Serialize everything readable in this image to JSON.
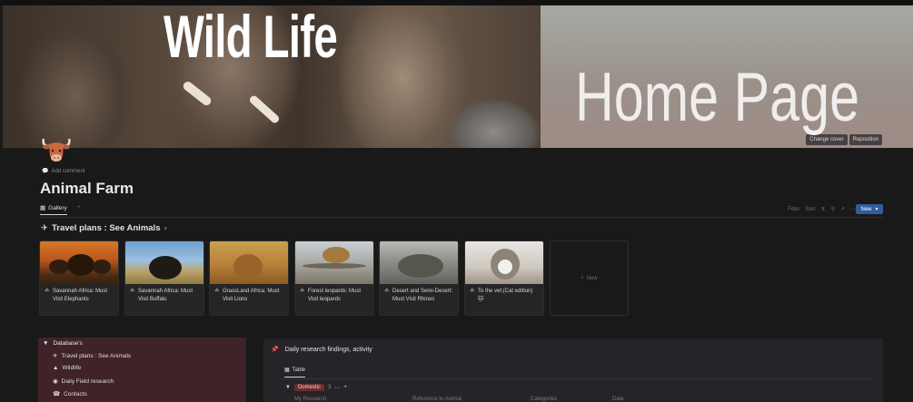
{
  "cover": {
    "title_left": "Wild Life",
    "title_right": "Home Page",
    "change_cover_label": "Change cover",
    "reposition_label": "Reposition"
  },
  "page": {
    "add_comment_label": "Add comment",
    "title": "Animal Farm"
  },
  "views": {
    "active_tab_label": "Gallery",
    "toolbar": {
      "filter_label": "Filter",
      "sort_label": "Sort",
      "new_button_label": "New"
    }
  },
  "gallery": {
    "title": "Travel plans : See Animals",
    "cards": [
      {
        "label": "Savannah Africa: Must Visit Elephants"
      },
      {
        "label": "Savannah Africa:  Must Visit Buffalo"
      },
      {
        "label": "GrassLand Africa: Must Visit Lions"
      },
      {
        "label": "Forest leopards: Must Visit leopards"
      },
      {
        "label": "Desert and Semi-Desert: Must Visit Rhinos"
      },
      {
        "label": "To the vet:(Cat edition) 🐱"
      }
    ],
    "new_card_label": "New"
  },
  "databases_block": {
    "header": "Database's",
    "items": [
      {
        "label": "Travel plans : See Animals",
        "icon": "airplane-icon"
      },
      {
        "label": "Wildlife",
        "icon": "tree-icon"
      },
      {
        "label": "Daily Field research",
        "icon": "binoculars-icon"
      },
      {
        "label": "Contacts",
        "icon": "contacts-icon"
      }
    ]
  },
  "research": {
    "title": "Daily research findings, activity",
    "tab_label": "Table",
    "group_label": "Domestic",
    "group_count": "3",
    "columns": [
      "My Research",
      "Reference to Animal",
      "Categories",
      "Date"
    ]
  },
  "colors": {
    "accent_blue": "#2f5e9a",
    "db_block_bg": "#3f2328",
    "domestic_pill": "#6b2c2c"
  }
}
